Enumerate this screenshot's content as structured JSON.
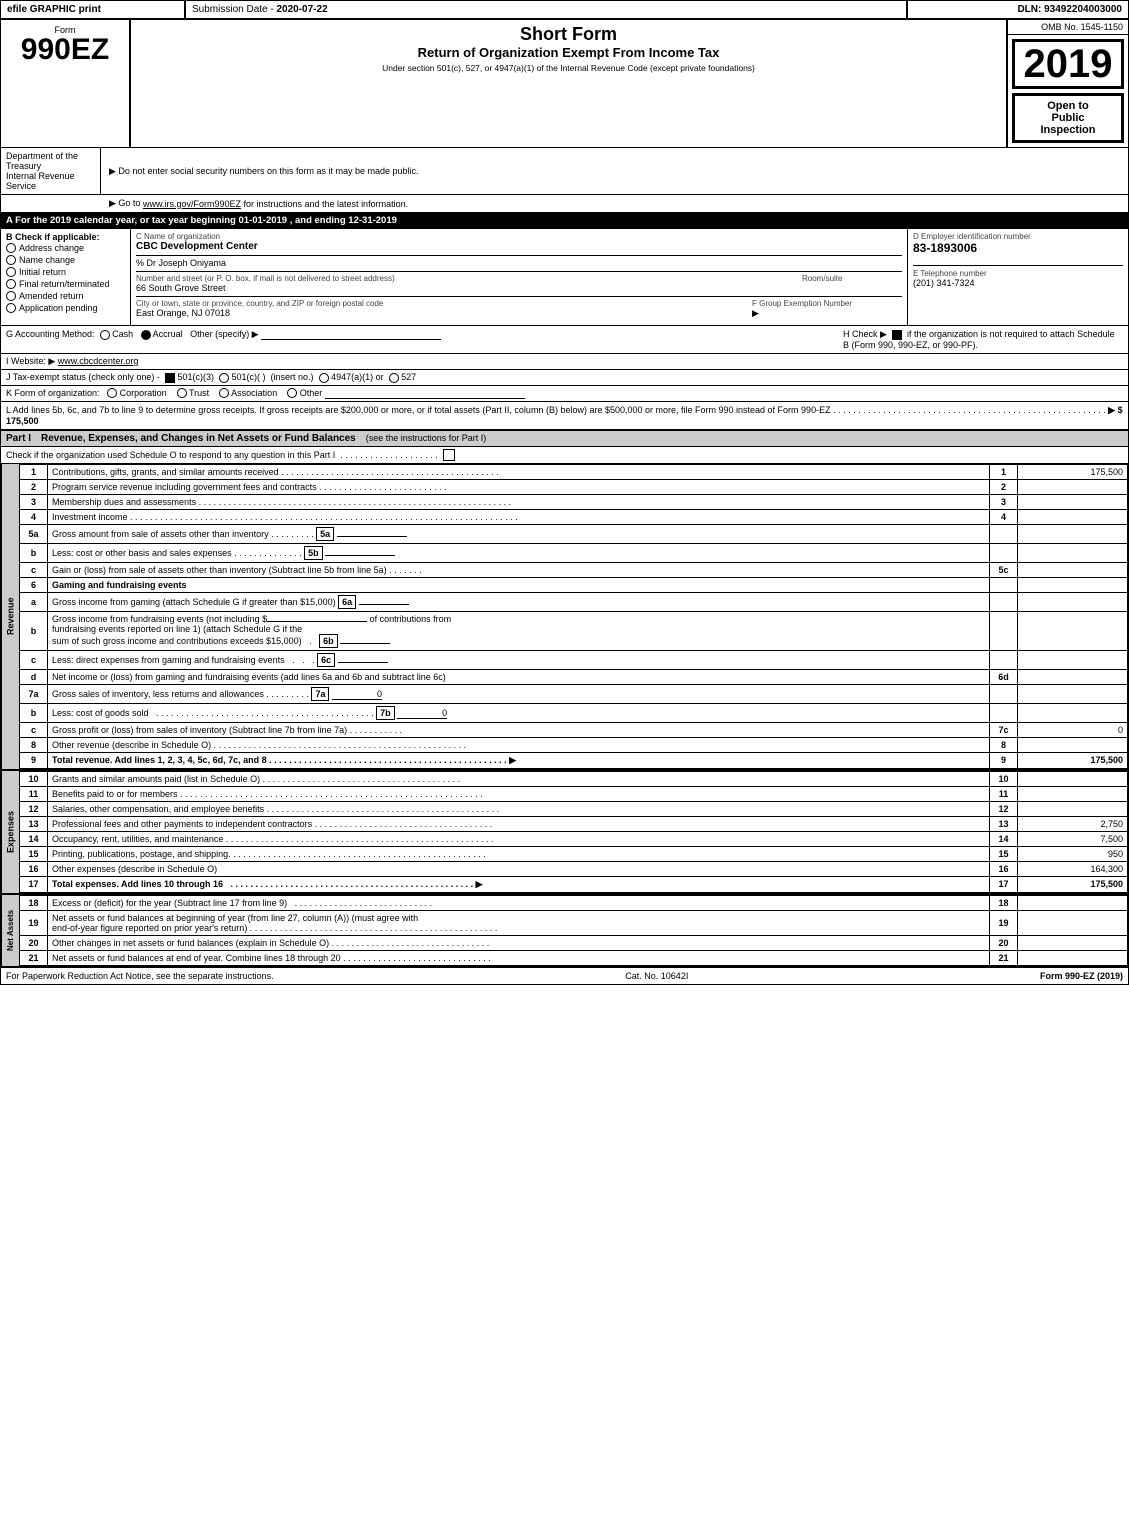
{
  "header": {
    "efile": "efile GRAPHIC print",
    "submission_label": "Submission Date -",
    "submission_date": "2020-07-22",
    "dln_label": "DLN:",
    "dln": "93492204003000"
  },
  "form": {
    "number": "990EZ",
    "label": "Form",
    "title_main": "Short Form",
    "title_sub": "Return of Organization Exempt From Income Tax",
    "title_note": "Under section 501(c), 527, or 4947(a)(1) of the Internal Revenue Code (except private foundations)",
    "year": "2019",
    "omb": "OMB No. 1545-1150",
    "open_to_public": "Open to",
    "public": "Public",
    "inspection": "Inspection",
    "do_not_enter": "▶ Do not enter social security numbers on this form as it may be made public.",
    "go_to": "▶ Go to",
    "go_to_link": "www.irs.gov/Form990EZ",
    "go_to_rest": "for instructions and the latest information."
  },
  "section_a": {
    "label": "A  For the 2019 calendar year, or tax year beginning 01-01-2019 , and ending 12-31-2019"
  },
  "section_b": {
    "label": "B  Check if applicable:",
    "items": [
      {
        "id": "address-change",
        "label": "Address change",
        "checked": false
      },
      {
        "id": "name-change",
        "label": "Name change",
        "checked": false
      },
      {
        "id": "initial-return",
        "label": "Initial return",
        "checked": false
      },
      {
        "id": "final-return",
        "label": "Final return/terminated",
        "checked": false
      },
      {
        "id": "amended-return",
        "label": "Amended return",
        "checked": false
      },
      {
        "id": "application-pending",
        "label": "Application pending",
        "checked": false
      }
    ]
  },
  "org_info": {
    "c_label": "C Name of organization",
    "org_name": "CBC Development Center",
    "care_of": "% Dr Joseph Oniyama",
    "address_label": "Number and street (or P. O. box, if mail is not delivered to street address)",
    "address": "66 South Grove Street",
    "room_suite_label": "Room/suite",
    "room_suite": "",
    "city_label": "City or town, state or province, country, and ZIP or foreign postal code",
    "city": "East Orange, NJ  07018",
    "f_group_label": "F Group Exemption Number",
    "f_group_arrow": "▶"
  },
  "employer": {
    "d_label": "D Employer identification number",
    "ein": "83-1893006",
    "e_label": "E Telephone number",
    "phone": "(201) 341-7324"
  },
  "accounting": {
    "g_label": "G Accounting Method:",
    "cash_label": "Cash",
    "accrual_label": "Accrual",
    "accrual_checked": true,
    "other_label": "Other (specify) ▶",
    "h_label": "H  Check ▶",
    "h_checked": true,
    "h_text": "if the organization is not required to attach Schedule B (Form 990, 990-EZ, or 990-PF)."
  },
  "website": {
    "i_label": "I Website: ▶",
    "url": "www.cbcdcenter.org"
  },
  "tax_status": {
    "j_label": "J Tax-exempt status (check only one) -",
    "option1_checked": true,
    "option1": "501(c)(3)",
    "option2": "501(c)(  )",
    "option2_insert": "(insert no.)",
    "option3": "4947(a)(1) or",
    "option4": "527"
  },
  "k_form": {
    "label": "K Form of organization:",
    "corporation": "Corporation",
    "trust": "Trust",
    "association": "Association",
    "other": "Other"
  },
  "l_section": {
    "text": "L Add lines 5b, 6c, and 7b to line 9 to determine gross receipts. If gross receipts are $200,000 or more, or if total assets (Part II, column (B) below) are $500,000 or more, file Form 990 instead of Form 990-EZ",
    "dots": ". . . . . . . . . . . . . . . . . . . . . . . . . . . . . . . . . . . . . . . . . . . . . . . . . . . . . . .",
    "arrow": "▶ $",
    "amount": "175,500"
  },
  "part1": {
    "header": "Part I",
    "title": "Revenue, Expenses, and Changes in Net Assets or Fund Balances",
    "see_instructions": "(see the instructions for Part I)",
    "check_text": "Check if the organization used Schedule O to respond to any question in this Part I",
    "dots": ". . . . . . . . . . . . . . . . . . . .",
    "revenue_label": "Revenue",
    "expenses_label": "Expenses",
    "net_assets_label": "Net Assets",
    "lines": [
      {
        "num": "1",
        "description": "Contributions, gifts, grants, and similar amounts received",
        "dots": ". . . . . . . . . . . . . . . . . . . . . . . . . . . . . . . . . . . . . . . .",
        "line_ref": "1",
        "amount": "175,500"
      },
      {
        "num": "2",
        "description": "Program service revenue including government fees and contracts",
        "dots": ". . . . . . . . . . . . . . . . . . . . . . . . .",
        "line_ref": "2",
        "amount": ""
      },
      {
        "num": "3",
        "description": "Membership dues and assessments",
        "dots": ". . . . . . . . . . . . . . . . . . . . . . . . . . . . . . . . . . . . . . . . . . . . . . . . . . . . . . . . .",
        "line_ref": "3",
        "amount": ""
      },
      {
        "num": "4",
        "description": "Investment income",
        "dots": ". . . . . . . . . . . . . . . . . . . . . . . . . . . . . . . . . . . . . . . . . . . . . . . . . . . . . . . . . . . . . . . . . . . . . . . . .",
        "line_ref": "4",
        "amount": ""
      },
      {
        "num": "5a",
        "description": "Gross amount from sale of assets other than inventory",
        "dots": ". . . . . . . . .",
        "box": "5a",
        "line_ref": "",
        "amount": ""
      },
      {
        "num": "b",
        "description": "Less: cost or other basis and sales expenses",
        "dots": ". . . . . . . . . . . . .",
        "box": "5b",
        "line_ref": "",
        "amount": ""
      },
      {
        "num": "c",
        "description": "Gain or (loss) from sale of assets other than inventory (Subtract line 5b from line 5a)",
        "dots": ". . . . . . .",
        "line_ref": "5c",
        "amount": ""
      },
      {
        "num": "6",
        "description": "Gaming and fundraising events",
        "line_ref": "",
        "amount": ""
      },
      {
        "num": "a",
        "description": "Gross income from gaming (attach Schedule G if greater than $15,000)",
        "box": "6a",
        "line_ref": "",
        "amount": ""
      },
      {
        "num": "b",
        "description": "Gross income from fundraising events (not including $",
        "description2": " of contributions from fundraising events reported on line 1) (attach Schedule G if the sum of such gross income and contributions exceeds $15,000)",
        "box": "6b",
        "dots": ". .",
        "line_ref": "",
        "amount": ""
      },
      {
        "num": "c",
        "description": "Less: direct expenses from gaming and fundraising events",
        "dots": ". . .",
        "box": "6c",
        "line_ref": "",
        "amount": ""
      },
      {
        "num": "d",
        "description": "Net income or (loss) from gaming and fundraising events (add lines 6a and 6b and subtract line 6c)",
        "line_ref": "6d",
        "amount": ""
      },
      {
        "num": "7a",
        "description": "Gross sales of inventory, less returns and allowances",
        "dots": ". . . . . . . . .",
        "box": "7a",
        "box_amount": "0",
        "line_ref": "",
        "amount": ""
      },
      {
        "num": "b",
        "description": "Less: cost of goods sold",
        "dots": ". . . . . . . . . . . . . . . . . . . . . . . . . . . . . . . . . . . . . . . . . .",
        "box": "7b",
        "box_amount": "0",
        "line_ref": "",
        "amount": ""
      },
      {
        "num": "c",
        "description": "Gross profit or (loss) from sales of inventory (Subtract line 7b from line 7a)",
        "dots": ". . . . . . . . . .",
        "line_ref": "7c",
        "amount": "0"
      },
      {
        "num": "8",
        "description": "Other revenue (describe in Schedule O)",
        "dots": ". . . . . . . . . . . . . . . . . . . . . . . . . . . . . . . . . . . . . . . . . . . . . . . . . .",
        "line_ref": "8",
        "amount": ""
      },
      {
        "num": "9",
        "description": "Total revenue. Add lines 1, 2, 3, 4, 5c, 6d, 7c, and 8",
        "dots": ". . . . . . . . . . . . . . . . . . . . . . . . . . . . . . . . . . . . . . . . . . . . . . . .",
        "arrow": "▶",
        "line_ref": "9",
        "amount": "175,500",
        "bold": true
      }
    ],
    "expense_lines": [
      {
        "num": "10",
        "description": "Grants and similar amounts paid (list in Schedule O)",
        "dots": ". . . . . . . . . . . . . . . . . . . . . . . . . . . . . . . . . . . . . . .",
        "line_ref": "10",
        "amount": ""
      },
      {
        "num": "11",
        "description": "Benefits paid to or for members",
        "dots": ". . . . . . . . . . . . . . . . . . . . . . . . . . . . . . . . . . . . . . . . . . . . . . . . . . . . . . . . . .",
        "line_ref": "11",
        "amount": ""
      },
      {
        "num": "12",
        "description": "Salaries, other compensation, and employee benefits",
        "dots": ". . . . . . . . . . . . . . . . . . . . . . . . . . . . . . . . . . . . . . . . . . . . . . .",
        "line_ref": "12",
        "amount": ""
      },
      {
        "num": "13",
        "description": "Professional fees and other payments to independent contractors",
        "dots": ". . . . . . . . . . . . . . . . . . . . . . . . . . . . . . . . . . .",
        "line_ref": "13",
        "amount": "2,750"
      },
      {
        "num": "14",
        "description": "Occupancy, rent, utilities, and maintenance",
        "dots": ". . . . . . . . . . . . . . . . . . . . . . . . . . . . . . . . . . . . . . . . . . . . . . . . . . . . .",
        "line_ref": "14",
        "amount": "7,500"
      },
      {
        "num": "15",
        "description": "Printing, publications, postage, and shipping.",
        "dots": ". . . . . . . . . . . . . . . . . . . . . . . . . . . . . . . . . . . . . . . . . . . . . . . . . .",
        "line_ref": "15",
        "amount": "950"
      },
      {
        "num": "16",
        "description": "Other expenses (describe in Schedule O)",
        "dots": "",
        "line_ref": "16",
        "amount": "164,300"
      },
      {
        "num": "17",
        "description": "Total expenses. Add lines 10 through 16",
        "dots": ". . . . . . . . . . . . . . . . . . . . . . . . . . . . . . . . . . . . . . . . . . . . . . . . .",
        "arrow": "▶",
        "line_ref": "17",
        "amount": "175,500",
        "bold": true
      }
    ],
    "net_asset_lines": [
      {
        "num": "18",
        "description": "Excess or (deficit) for the year (Subtract line 17 from line 9)",
        "dots": ". . . . . . . . . . . . . . . . . . . . . . . . . .",
        "line_ref": "18",
        "amount": ""
      },
      {
        "num": "19",
        "description": "Net assets or fund balances at beginning of year (from line 27, column (A)) (must agree with end-of-year figure reported on prior year's return)",
        "dots": ". . . . . . . . . . . . . . . . . . . . . . . . . . . . . . . . . . . . . . . . . . . . . . . . . . . . . . . . .",
        "line_ref": "19",
        "amount": ""
      },
      {
        "num": "20",
        "description": "Other changes in net assets or fund balances (explain in Schedule O)",
        "dots": ". . . . . . . . . . . . . . . . . . . . . . . . . . . . . . . . . . . .",
        "line_ref": "20",
        "amount": ""
      },
      {
        "num": "21",
        "description": "Net assets or fund balances at end of year. Combine lines 18 through 20",
        "dots": ". . . . . . . . . . . . . . . . . . . . . . . . . . . . . . .",
        "line_ref": "21",
        "amount": ""
      }
    ]
  },
  "footer": {
    "paperwork": "For Paperwork Reduction Act Notice, see the separate instructions.",
    "cat_no": "Cat. No. 10642I",
    "form_ref": "Form 990-EZ (2019)"
  },
  "dept": {
    "line1": "Department of the",
    "line2": "Treasury",
    "line3": "Internal Revenue",
    "line4": "Service"
  }
}
